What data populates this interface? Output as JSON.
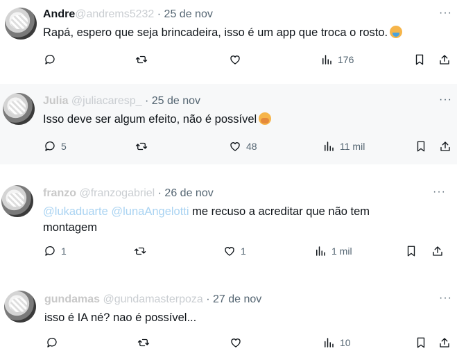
{
  "tweets": [
    {
      "name": "Andre",
      "name_blur": "ms5232",
      "handle": "@andrems5232",
      "date": "· 25 de nov",
      "text": "Rapá, espero que seja brincadeira, isso é um app que troca o rosto.",
      "emoji": "man-facepalming",
      "reply_count": "",
      "retweet_count": "",
      "like_count": "",
      "views": "176"
    },
    {
      "name": "Julia",
      "name_blur": "",
      "handle": "@juliacaresp_",
      "date": "· 25 de nov",
      "text": "Isso deve ser algum efeito, não é possível",
      "emoji": "hugging-face",
      "reply_count": "5",
      "retweet_count": "",
      "like_count": "48",
      "views": "11 mil"
    },
    {
      "name": "franzo",
      "name_blur": "",
      "handle": "@franzogabriel",
      "date": "· 26 de nov",
      "mention": "@lukaduarte @lunaAngelotti",
      "mention_visible": "otti",
      "text": " me recuso a acreditar que não tem",
      "text_line2": "montagem",
      "reply_count": "1",
      "retweet_count": "",
      "like_count": "1",
      "views": "1 mil"
    },
    {
      "name": "gundamas",
      "name_blur": "",
      "handle": "@gundamasterpoza",
      "date": "· 27 de nov",
      "text": "isso é IA né? nao é possível...",
      "reply_count": "",
      "retweet_count": "",
      "like_count": "",
      "views": "10"
    }
  ],
  "icons": {
    "reply": "reply-icon",
    "retweet": "retweet-icon",
    "like": "like-icon",
    "views": "views-icon",
    "bookmark": "bookmark-icon",
    "share": "share-icon",
    "more": "more-icon"
  },
  "more_label": "···",
  "colors": {
    "text": "#0f1419",
    "muted": "#536471",
    "link": "#1d9bf0",
    "alt_bg": "#f7f8f9"
  }
}
